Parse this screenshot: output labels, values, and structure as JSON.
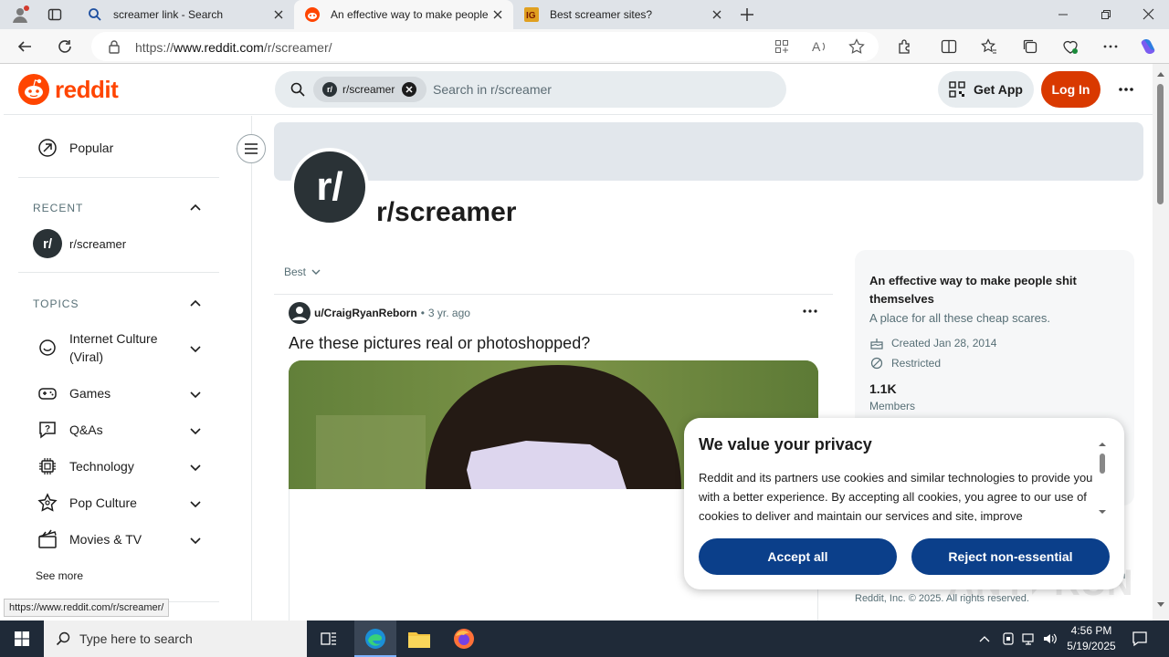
{
  "browser": {
    "tabs": [
      {
        "title": "screamer link - Search",
        "active": false
      },
      {
        "title": "An effective way to make people",
        "active": true
      },
      {
        "title": "Best screamer sites?",
        "active": false
      }
    ],
    "url_prefix": "https://",
    "url_domain": "www.reddit.com",
    "url_path": "/r/screamer/",
    "status_url": "https://www.reddit.com/r/screamer/"
  },
  "header": {
    "logo_text": "reddit",
    "search_chip": "r/screamer",
    "search_placeholder": "Search in r/screamer",
    "get_app": "Get App",
    "login": "Log In"
  },
  "sidebar": {
    "popular": "Popular",
    "recent_heading": "RECENT",
    "recent_item": "r/screamer",
    "topics_heading": "TOPICS",
    "topics": [
      {
        "label": "Internet Culture (Viral)",
        "icon": "smile-icon"
      },
      {
        "label": "Games",
        "icon": "gamepad-icon"
      },
      {
        "label": "Q&As",
        "icon": "question-icon"
      },
      {
        "label": "Technology",
        "icon": "chip-icon"
      },
      {
        "label": "Pop Culture",
        "icon": "star-icon"
      },
      {
        "label": "Movies & TV",
        "icon": "clapper-icon"
      }
    ],
    "see_more": "See more"
  },
  "subreddit": {
    "icon_text": "r/",
    "name": "r/screamer",
    "sort": "Best"
  },
  "post": {
    "author": "u/CraigRyanReborn",
    "age": "3 yr. ago",
    "title": "Are these pictures real or photoshopped?"
  },
  "about": {
    "title": "An effective way to make people shit themselves",
    "description": "A place for all these cheap scares.",
    "created": "Created Jan 28, 2014",
    "restricted": "Restricted",
    "members_count": "1.1K",
    "members_label": "Members",
    "footer": "Reddit, Inc. © 2025. All rights reserved.",
    "footer_cut": "um"
  },
  "privacy": {
    "title": "We value your privacy",
    "body": "Reddit and its partners use cookies and similar technologies to provide you with a better experience. By accepting all cookies, you agree to our use of cookies to deliver and maintain our services and site, improve",
    "accept": "Accept all",
    "reject": "Reject non-essential"
  },
  "taskbar": {
    "search_placeholder": "Type here to search",
    "time": "4:56 PM",
    "date": "5/19/2025"
  },
  "colors": {
    "reddit_orange": "#ff4500",
    "login_button": "#d93900",
    "privacy_button": "#0b3f8a"
  }
}
